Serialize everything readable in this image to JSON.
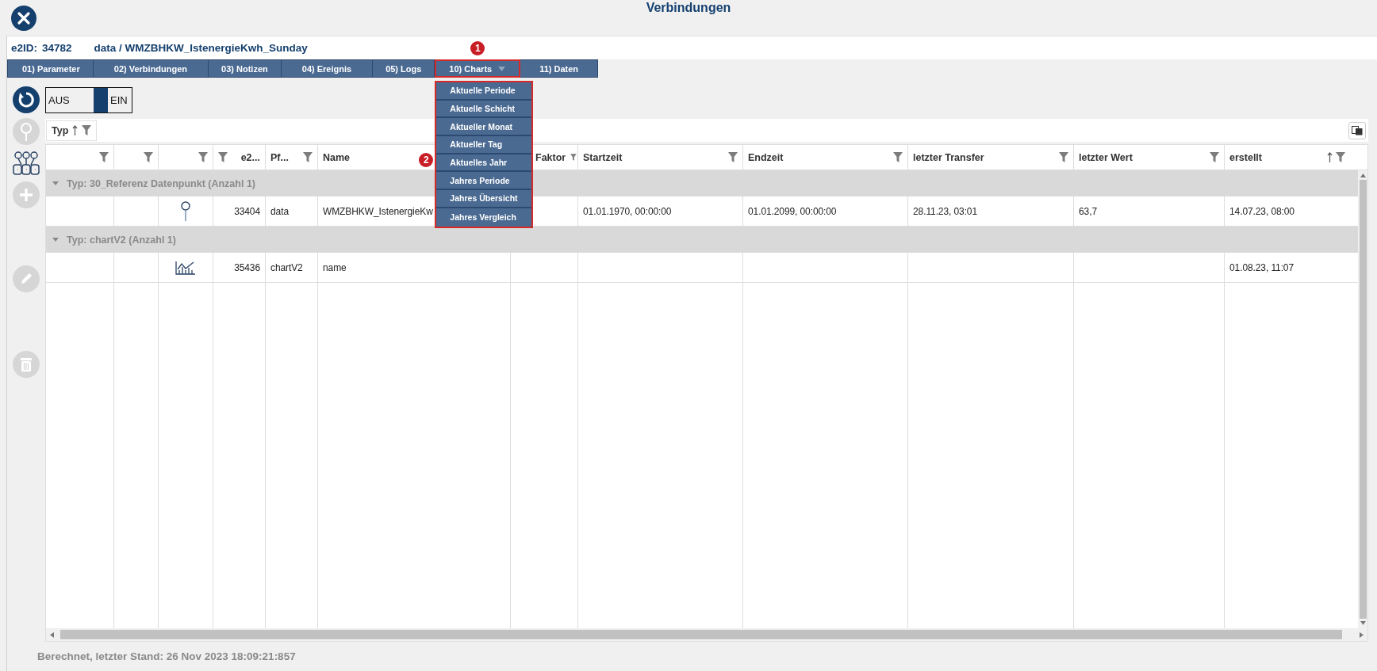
{
  "window": {
    "title": "Verbindungen"
  },
  "header": {
    "id_label": "e2ID:",
    "id": "34782",
    "path": "data / WMZBHKW_IstenergieKwh_Sunday"
  },
  "tabs": [
    {
      "label": "01) Parameter",
      "selected": false
    },
    {
      "label": "02) Verbindungen",
      "selected": false
    },
    {
      "label": "03) Notizen",
      "selected": false
    },
    {
      "label": "04) Ereignis",
      "selected": false
    },
    {
      "label": "05) Logs",
      "selected": false
    },
    {
      "label": "10) Charts",
      "selected": false,
      "marker": "1",
      "menu": {
        "expanded": true,
        "marker": "2",
        "items": [
          "Aktuelle Periode",
          "Aktuelle Schicht",
          "Aktueller Monat",
          "Aktueller Tag",
          "Aktuelles Jahr",
          "Jahres Periode",
          "Jahres Übersicht",
          "Jahres Vergleich"
        ]
      }
    },
    {
      "label": "11) Daten",
      "selected": false
    }
  ],
  "toolbar": [
    {
      "kind": "refresh",
      "disabled": false
    },
    {
      "kind": "pin",
      "disabled": true
    },
    {
      "kind": "bags",
      "disabled": false
    },
    {
      "kind": "add",
      "disabled": true
    },
    {
      "kind": "edit",
      "disabled": true
    },
    {
      "kind": "delete",
      "disabled": true
    }
  ],
  "toggle": {
    "off_label": "AUS",
    "on_label": "EIN",
    "on": true
  },
  "grouping": {
    "label": "Typ",
    "sorted": true
  },
  "table": {
    "columns": [
      {
        "filter": true
      },
      {
        "filter": true
      },
      {
        "filter": true
      },
      {
        "label": "e2...",
        "filter": true
      },
      {
        "label": "Pf...",
        "filter": true
      },
      {
        "label": "Name"
      },
      {
        "label": "Faktor",
        "filter": true
      },
      {
        "label": "Startzeit",
        "filter": true
      },
      {
        "label": "Endzeit",
        "filter": true
      },
      {
        "label": "letzter Transfer",
        "filter": true
      },
      {
        "label": "letzter Wert",
        "filter": true
      },
      {
        "label": "erstellt",
        "filter": true,
        "sorted": true
      }
    ],
    "groups": [
      {
        "title": "Typ: 30_Referenz Datenpunkt (Anzahl 1)",
        "expanded": true,
        "rows": [
          {
            "kind": "pin",
            "e2id": "33404",
            "pfad": "data",
            "name": "WMZBHKW_IstenergieKw",
            "startzeit": "01.01.1970, 00:00:00",
            "endzeit": "01.01.2099, 00:00:00",
            "letzter_transfer": "28.11.23, 03:01",
            "letzter_wert": "63,7",
            "erstellt": "14.07.23, 08:00"
          }
        ]
      },
      {
        "title": "Typ: chartV2 (Anzahl 1)",
        "expanded": true,
        "rows": [
          {
            "kind": "chart",
            "e2id": "35436",
            "pfad": "chartV2",
            "name": "name",
            "erstellt": "01.08.23, 11:07"
          }
        ]
      }
    ]
  },
  "status": "Berechnet, letzter Stand: 26 Nov 2023 18:09:21:857"
}
